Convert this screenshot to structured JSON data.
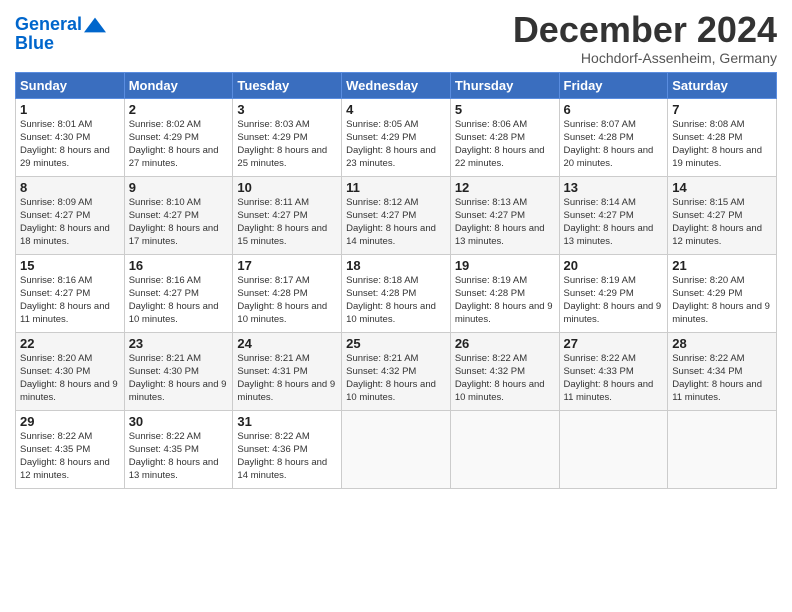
{
  "header": {
    "logo_line1": "General",
    "logo_line2": "Blue",
    "month": "December 2024",
    "location": "Hochdorf-Assenheim, Germany"
  },
  "days_of_week": [
    "Sunday",
    "Monday",
    "Tuesday",
    "Wednesday",
    "Thursday",
    "Friday",
    "Saturday"
  ],
  "weeks": [
    [
      {
        "day": 1,
        "sunrise": "8:01 AM",
        "sunset": "4:30 PM",
        "daylight": "8 hours and 29 minutes."
      },
      {
        "day": 2,
        "sunrise": "8:02 AM",
        "sunset": "4:29 PM",
        "daylight": "8 hours and 27 minutes."
      },
      {
        "day": 3,
        "sunrise": "8:03 AM",
        "sunset": "4:29 PM",
        "daylight": "8 hours and 25 minutes."
      },
      {
        "day": 4,
        "sunrise": "8:05 AM",
        "sunset": "4:29 PM",
        "daylight": "8 hours and 23 minutes."
      },
      {
        "day": 5,
        "sunrise": "8:06 AM",
        "sunset": "4:28 PM",
        "daylight": "8 hours and 22 minutes."
      },
      {
        "day": 6,
        "sunrise": "8:07 AM",
        "sunset": "4:28 PM",
        "daylight": "8 hours and 20 minutes."
      },
      {
        "day": 7,
        "sunrise": "8:08 AM",
        "sunset": "4:28 PM",
        "daylight": "8 hours and 19 minutes."
      }
    ],
    [
      {
        "day": 8,
        "sunrise": "8:09 AM",
        "sunset": "4:27 PM",
        "daylight": "8 hours and 18 minutes."
      },
      {
        "day": 9,
        "sunrise": "8:10 AM",
        "sunset": "4:27 PM",
        "daylight": "8 hours and 17 minutes."
      },
      {
        "day": 10,
        "sunrise": "8:11 AM",
        "sunset": "4:27 PM",
        "daylight": "8 hours and 15 minutes."
      },
      {
        "day": 11,
        "sunrise": "8:12 AM",
        "sunset": "4:27 PM",
        "daylight": "8 hours and 14 minutes."
      },
      {
        "day": 12,
        "sunrise": "8:13 AM",
        "sunset": "4:27 PM",
        "daylight": "8 hours and 13 minutes."
      },
      {
        "day": 13,
        "sunrise": "8:14 AM",
        "sunset": "4:27 PM",
        "daylight": "8 hours and 13 minutes."
      },
      {
        "day": 14,
        "sunrise": "8:15 AM",
        "sunset": "4:27 PM",
        "daylight": "8 hours and 12 minutes."
      }
    ],
    [
      {
        "day": 15,
        "sunrise": "8:16 AM",
        "sunset": "4:27 PM",
        "daylight": "8 hours and 11 minutes."
      },
      {
        "day": 16,
        "sunrise": "8:16 AM",
        "sunset": "4:27 PM",
        "daylight": "8 hours and 10 minutes."
      },
      {
        "day": 17,
        "sunrise": "8:17 AM",
        "sunset": "4:28 PM",
        "daylight": "8 hours and 10 minutes."
      },
      {
        "day": 18,
        "sunrise": "8:18 AM",
        "sunset": "4:28 PM",
        "daylight": "8 hours and 10 minutes."
      },
      {
        "day": 19,
        "sunrise": "8:19 AM",
        "sunset": "4:28 PM",
        "daylight": "8 hours and 9 minutes."
      },
      {
        "day": 20,
        "sunrise": "8:19 AM",
        "sunset": "4:29 PM",
        "daylight": "8 hours and 9 minutes."
      },
      {
        "day": 21,
        "sunrise": "8:20 AM",
        "sunset": "4:29 PM",
        "daylight": "8 hours and 9 minutes."
      }
    ],
    [
      {
        "day": 22,
        "sunrise": "8:20 AM",
        "sunset": "4:30 PM",
        "daylight": "8 hours and 9 minutes."
      },
      {
        "day": 23,
        "sunrise": "8:21 AM",
        "sunset": "4:30 PM",
        "daylight": "8 hours and 9 minutes."
      },
      {
        "day": 24,
        "sunrise": "8:21 AM",
        "sunset": "4:31 PM",
        "daylight": "8 hours and 9 minutes."
      },
      {
        "day": 25,
        "sunrise": "8:21 AM",
        "sunset": "4:32 PM",
        "daylight": "8 hours and 10 minutes."
      },
      {
        "day": 26,
        "sunrise": "8:22 AM",
        "sunset": "4:32 PM",
        "daylight": "8 hours and 10 minutes."
      },
      {
        "day": 27,
        "sunrise": "8:22 AM",
        "sunset": "4:33 PM",
        "daylight": "8 hours and 11 minutes."
      },
      {
        "day": 28,
        "sunrise": "8:22 AM",
        "sunset": "4:34 PM",
        "daylight": "8 hours and 11 minutes."
      }
    ],
    [
      {
        "day": 29,
        "sunrise": "8:22 AM",
        "sunset": "4:35 PM",
        "daylight": "8 hours and 12 minutes."
      },
      {
        "day": 30,
        "sunrise": "8:22 AM",
        "sunset": "4:35 PM",
        "daylight": "8 hours and 13 minutes."
      },
      {
        "day": 31,
        "sunrise": "8:22 AM",
        "sunset": "4:36 PM",
        "daylight": "8 hours and 14 minutes."
      },
      null,
      null,
      null,
      null
    ]
  ]
}
